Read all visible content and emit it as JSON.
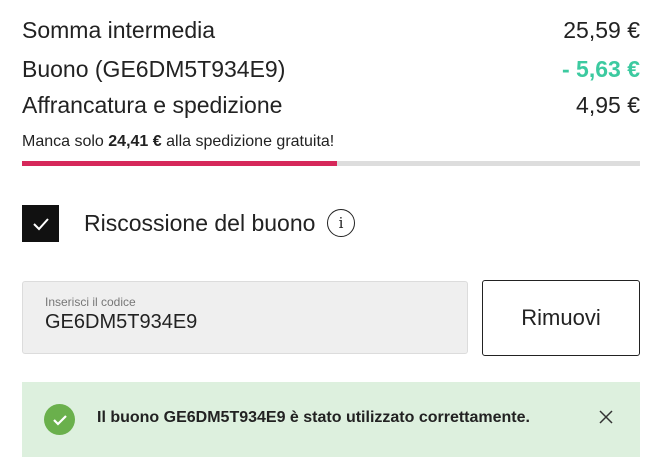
{
  "summary": {
    "rows": [
      {
        "label": "Somma intermedia",
        "value": "25,59 €"
      },
      {
        "label": "Buono (GE6DM5T934E9)",
        "value": "- 5,63 €"
      },
      {
        "label": "Affrancatura e spedizione",
        "value": "4,95 €"
      }
    ]
  },
  "shipping": {
    "prefix": "Manca solo",
    "amount": "24,41 €",
    "suffix": "alla spedizione gratuita!",
    "progress_percent": 51
  },
  "voucher": {
    "checkbox_label": "Riscossione del buono",
    "checked": true,
    "field_label": "Inserisci il codice",
    "code_value": "GE6DM5T934E9",
    "remove_label": "Rimuovi",
    "success_message": "Il buono GE6DM5T934E9 è stato utilizzato correttamente."
  },
  "colors": {
    "discount": "#3ccaa0",
    "progress": "#d6285a",
    "success_bg": "#ddf0de",
    "success_icon": "#6ab04c"
  },
  "icons": {
    "checkbox": "check-icon",
    "info": "info-icon",
    "success": "check-circle-icon",
    "close": "close-icon"
  }
}
